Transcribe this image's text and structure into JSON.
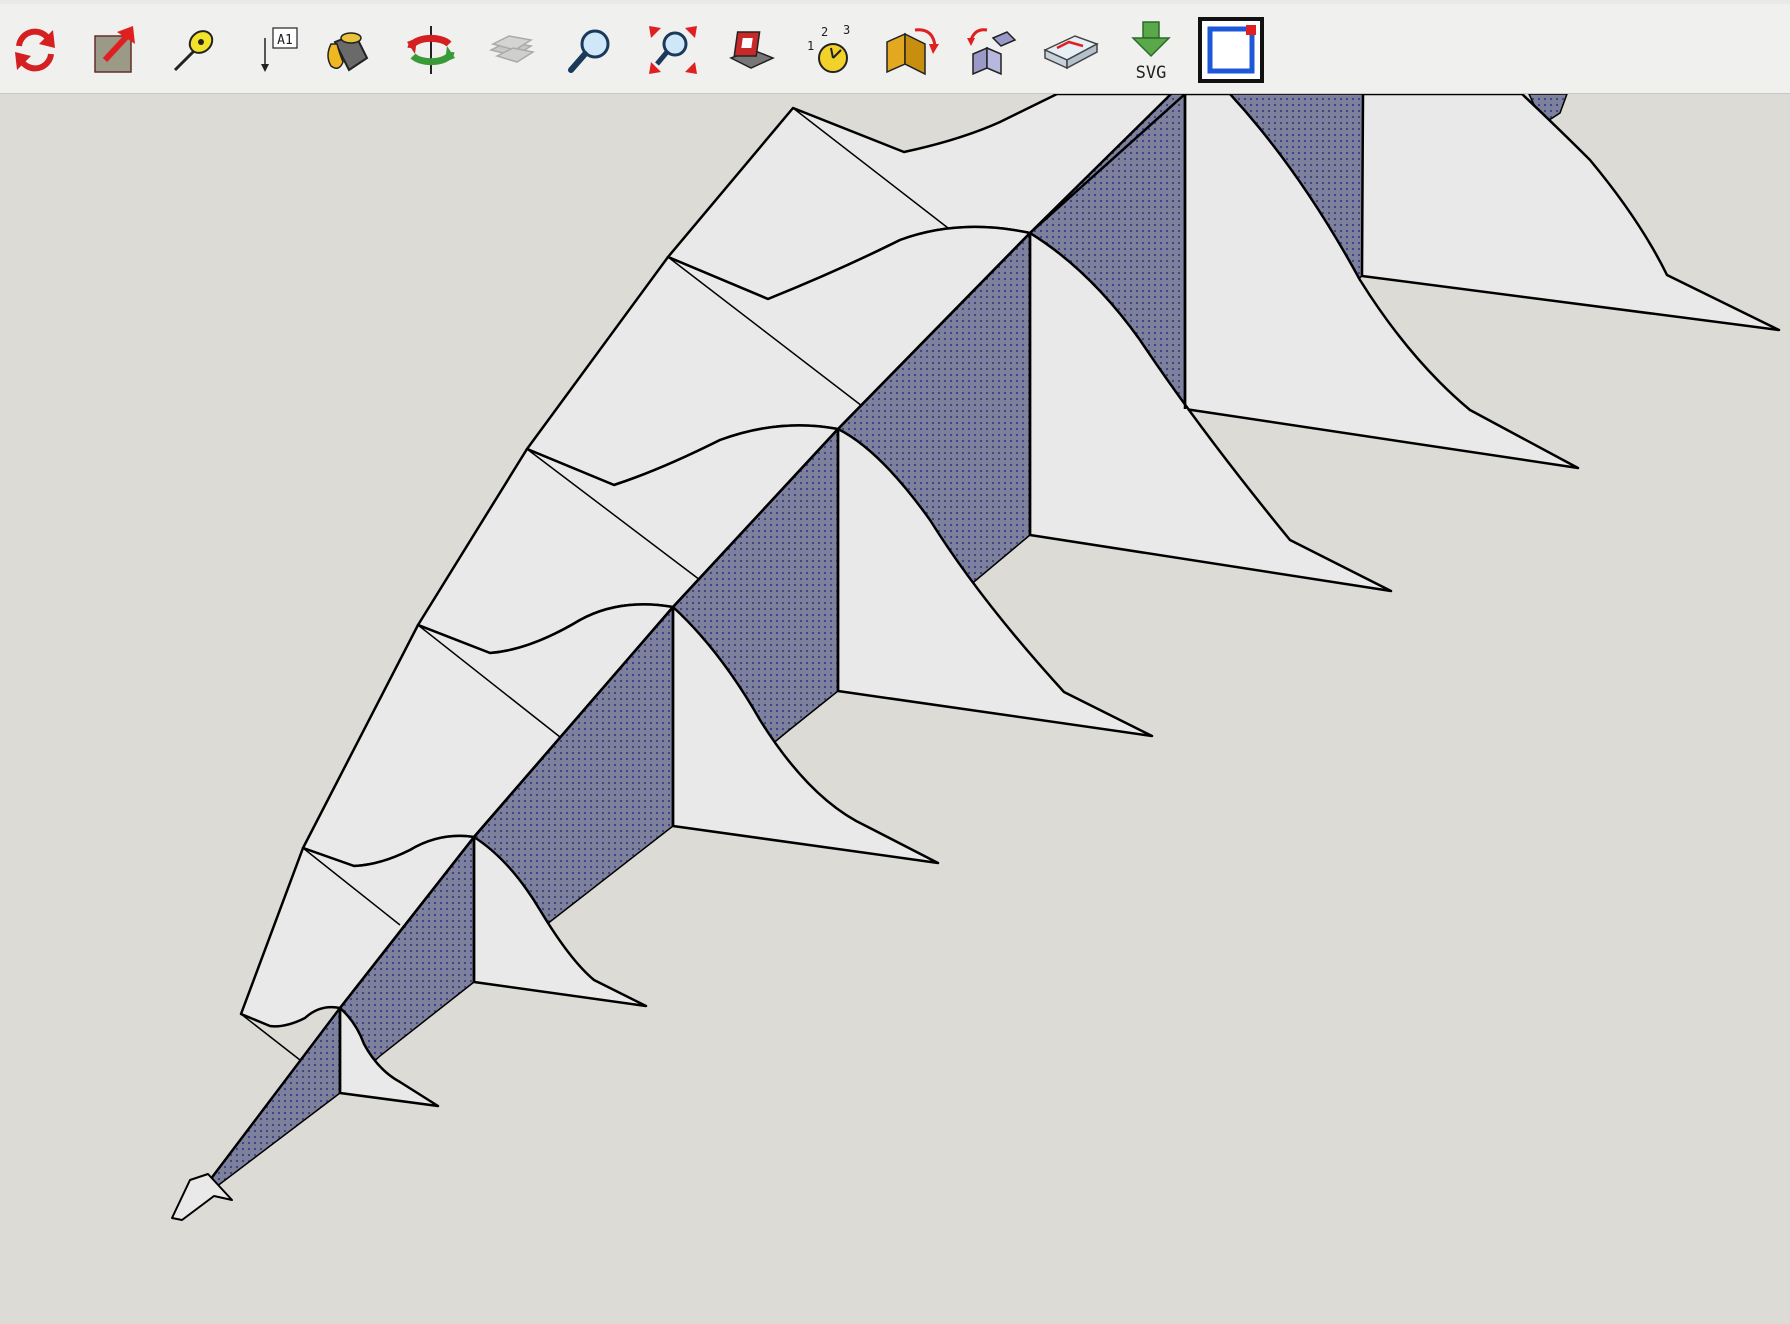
{
  "toolbar": {
    "tools": [
      {
        "name": "refresh-tool",
        "icon": "refresh-icon"
      },
      {
        "name": "push-pull-export-tool",
        "icon": "export-arrow-icon"
      },
      {
        "name": "tape-measure-tool",
        "icon": "tape-measure-icon"
      },
      {
        "name": "text-tool",
        "icon": "text-label-icon",
        "label": "A1"
      },
      {
        "name": "paint-bucket-tool",
        "icon": "paint-bucket-icon"
      },
      {
        "name": "orbit-tool",
        "icon": "orbit-icon"
      },
      {
        "name": "layers-tool",
        "icon": "layers-icon"
      },
      {
        "name": "zoom-tool",
        "icon": "magnifier-icon"
      },
      {
        "name": "zoom-extents-tool",
        "icon": "zoom-extents-icon"
      },
      {
        "name": "shadow-tool",
        "icon": "shadow-icon"
      },
      {
        "name": "numbered-tool",
        "icon": "numbered-counter-icon",
        "label": "1 2 3"
      },
      {
        "name": "sandbox-flip-tool",
        "icon": "flip-component-icon"
      },
      {
        "name": "components-tool",
        "icon": "components-icon"
      },
      {
        "name": "section-plane-tool",
        "icon": "section-plane-icon"
      },
      {
        "name": "svg-export-tool",
        "icon": "svg-download-icon",
        "label": "SVG"
      },
      {
        "name": "page-view-tool",
        "icon": "page-frame-icon"
      }
    ]
  },
  "colors": {
    "toolbar_bg": "#f0f0ef",
    "canvas_bg": "#dcdbd6",
    "panel_shaded": "#7b809f",
    "panel_light": "#e9e9e9",
    "edge": "#000000",
    "accent_red": "#e02020",
    "accent_blue": "#1e57d8"
  }
}
